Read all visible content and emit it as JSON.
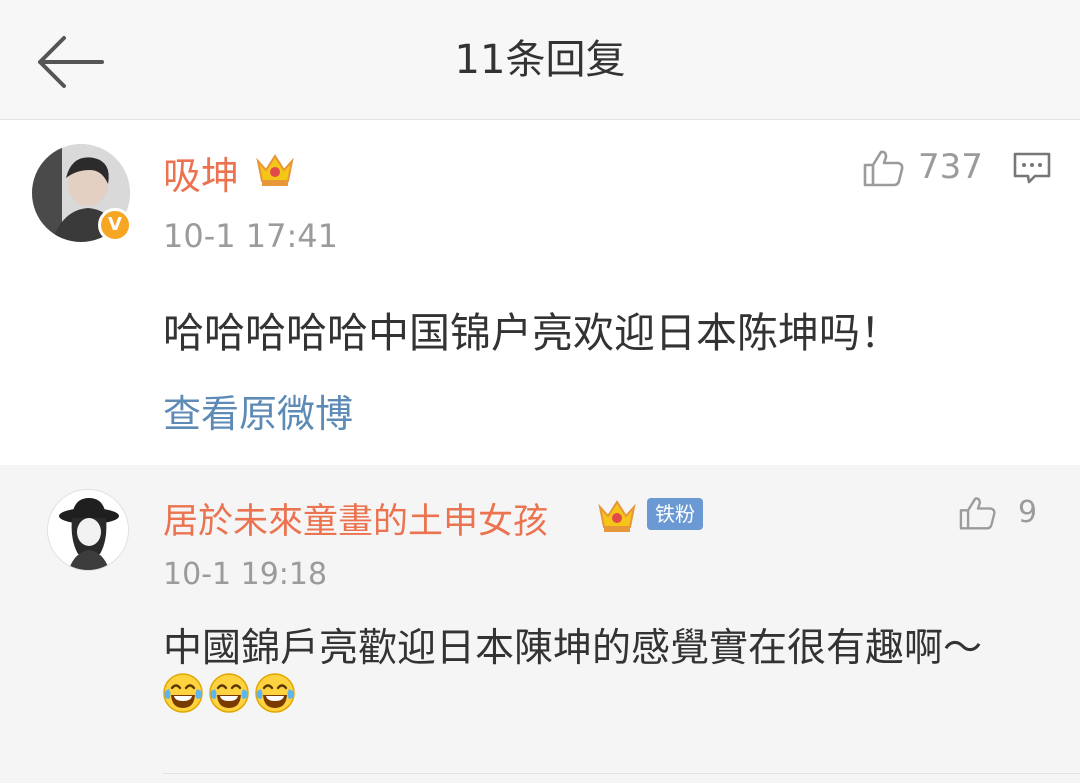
{
  "header": {
    "title": "11条回复",
    "back_icon": "arrow-left-icon"
  },
  "main_comment": {
    "username": "吸坤",
    "user_badge_icon": "crown-icon",
    "verified_icon": "verified-v-icon",
    "verified_letter": "V",
    "timestamp": "10-1 17:41",
    "like_count": "737",
    "text": "哈哈哈哈哈中国锦户亮欢迎日本陈坤吗！",
    "view_original_label": "查看原微博"
  },
  "reply": {
    "username": "居於未來童畫的土申女孩",
    "user_badge_icon": "crown-icon",
    "fan_badge": "铁粉",
    "like_count": "9",
    "timestamp": "10-1 19:18",
    "text": "中國錦戶亮歡迎日本陳坤的感覺實在很有趣啊～",
    "emojis": [
      "laughing-tears-icon",
      "laughing-tears-icon",
      "laughing-tears-icon"
    ]
  },
  "colors": {
    "username": "#eb7350",
    "link": "#5d8bb6",
    "meta": "#9b9b9b",
    "text": "#333333",
    "reply_bg": "#f5f5f5",
    "header_bg": "#f7f7f7",
    "fan_badge_bg": "#6a99d3",
    "verified_bg": "#f6a623"
  }
}
